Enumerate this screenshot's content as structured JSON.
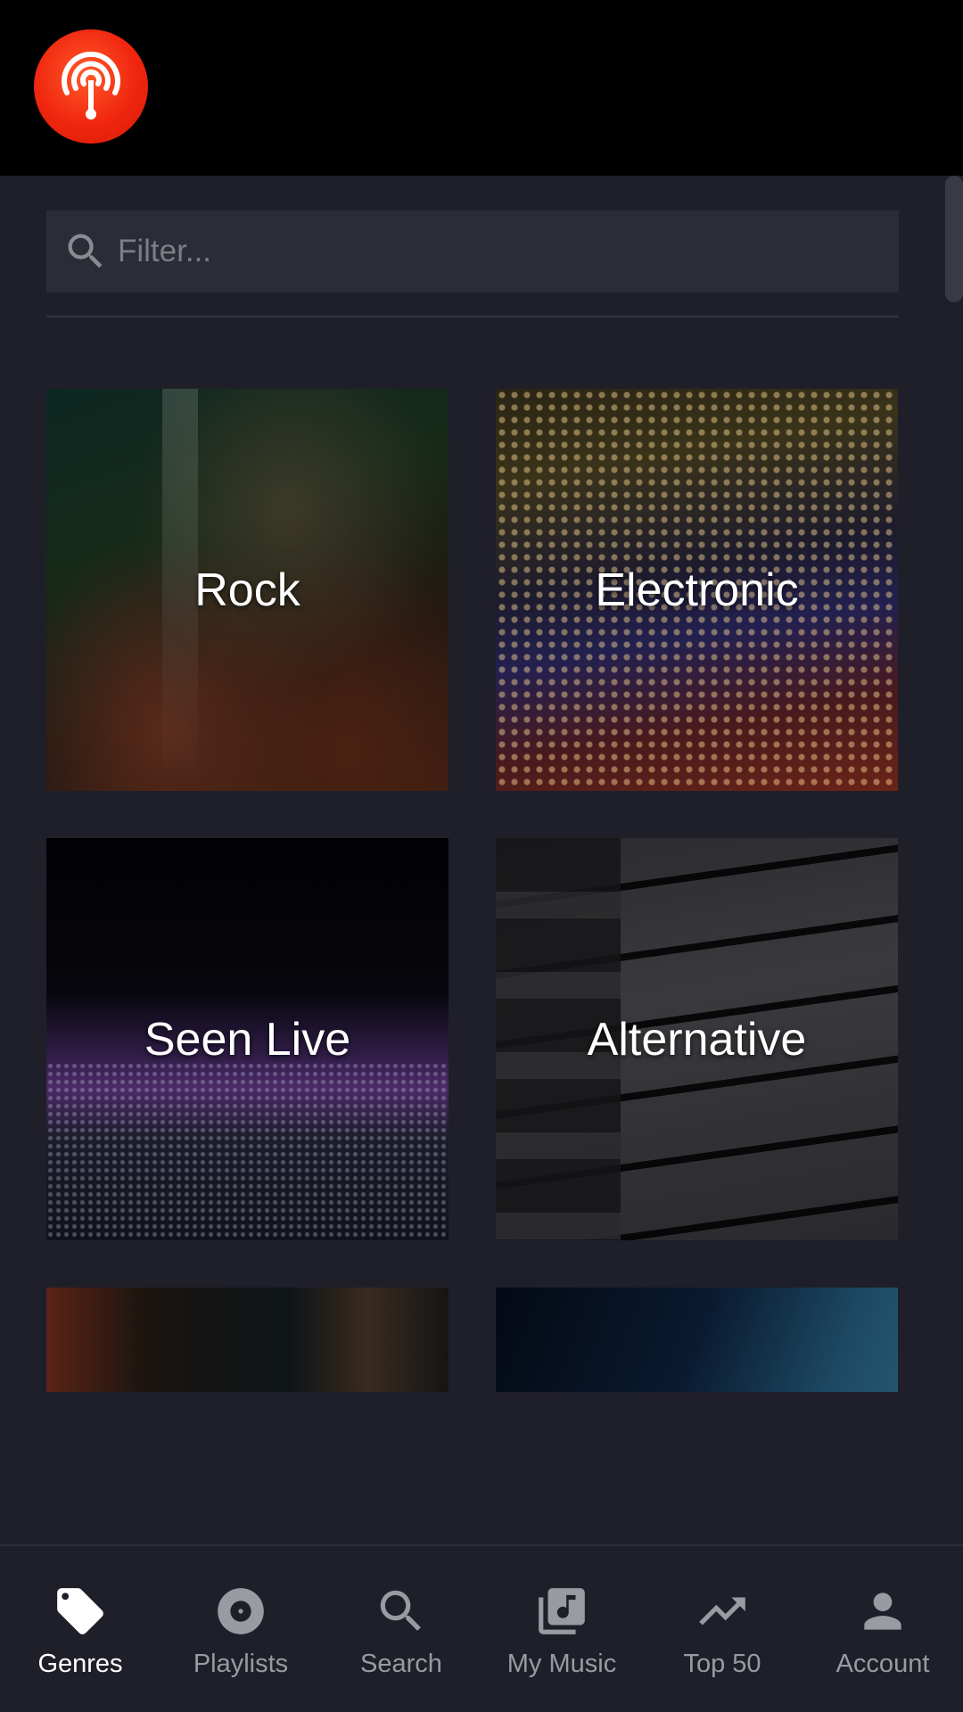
{
  "header": {
    "logo_icon": "podcast-broadcast-icon",
    "logo_color": "#f0260f"
  },
  "filter": {
    "placeholder": "Filter..."
  },
  "genres": [
    {
      "label": "Rock"
    },
    {
      "label": "Electronic"
    },
    {
      "label": "Seen Live"
    },
    {
      "label": "Alternative"
    },
    {
      "label": ""
    },
    {
      "label": ""
    }
  ],
  "nav": {
    "items": [
      {
        "label": "Genres",
        "icon": "tag-icon",
        "active": true
      },
      {
        "label": "Playlists",
        "icon": "disc-icon",
        "active": false
      },
      {
        "label": "Search",
        "icon": "search-icon",
        "active": false
      },
      {
        "label": "My Music",
        "icon": "music-library-icon",
        "active": false
      },
      {
        "label": "Top 50",
        "icon": "trending-up-icon",
        "active": false
      },
      {
        "label": "Account",
        "icon": "person-icon",
        "active": false
      }
    ]
  },
  "colors": {
    "background": "#1f1f29",
    "header": "#000000",
    "active_nav": "#ffffff",
    "inactive_nav": "#9a9aa2"
  }
}
